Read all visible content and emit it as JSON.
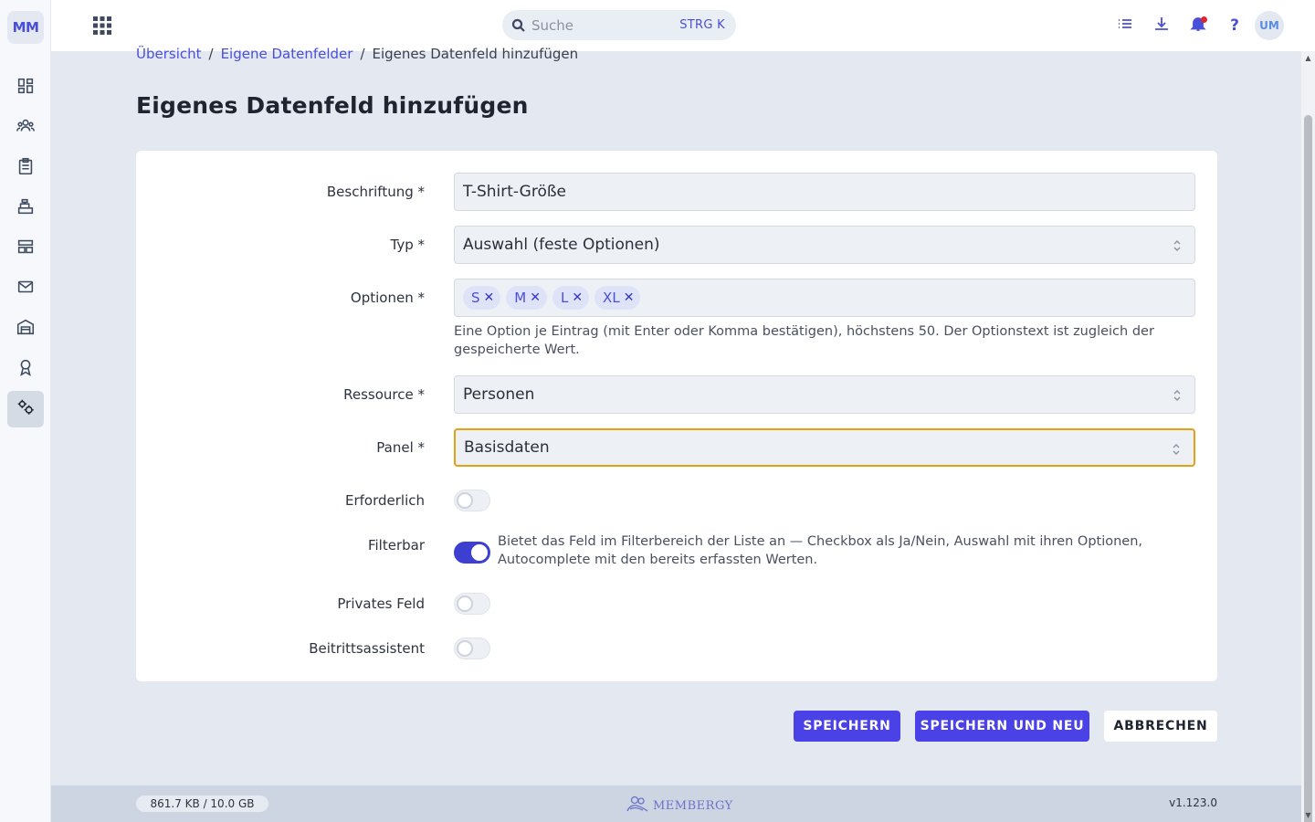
{
  "app": {
    "logo_initials": "MM",
    "user_initials": "UM"
  },
  "sidebar": {
    "items": [
      {
        "icon": "dashboard-icon",
        "active": false
      },
      {
        "icon": "people-icon",
        "active": false
      },
      {
        "icon": "clipboard-icon",
        "active": false
      },
      {
        "icon": "cash-register-icon",
        "active": false
      },
      {
        "icon": "layout-icon",
        "active": false
      },
      {
        "icon": "mail-icon",
        "active": false
      },
      {
        "icon": "warehouse-icon",
        "active": false
      },
      {
        "icon": "award-icon",
        "active": false
      },
      {
        "icon": "settings-gears-icon",
        "active": true
      }
    ]
  },
  "topbar": {
    "search_placeholder": "Suche",
    "search_shortcut": "STRG K",
    "help_label": "?",
    "notification_dot_color": "#e0262f"
  },
  "breadcrumb": [
    "Übersicht",
    "Eigene Datenfelder",
    "Eigenes Datenfeld hinzufügen"
  ],
  "page": {
    "title": "Eigenes Datenfeld hinzufügen"
  },
  "form": {
    "label_field": {
      "label": "Beschriftung *",
      "value": "T-Shirt-Größe"
    },
    "type_field": {
      "label": "Typ *",
      "value": "Auswahl (feste Optionen)"
    },
    "options_field": {
      "label": "Optionen *",
      "chips": [
        "S",
        "M",
        "L",
        "XL"
      ],
      "remove_symbol": "✕",
      "hint": "Eine Option je Eintrag (mit Enter oder Komma bestätigen), höchstens 50. Der Optionstext ist zugleich der gespeicherte Wert."
    },
    "resource_field": {
      "label": "Ressource *",
      "value": "Personen"
    },
    "panel_field": {
      "label": "Panel *",
      "value": "Basisdaten"
    },
    "required_toggle": {
      "label": "Erforderlich",
      "on": false
    },
    "filterable_toggle": {
      "label": "Filterbar",
      "on": true,
      "hint": "Bietet das Feld im Filterbereich der Liste an — Checkbox als Ja/Nein, Auswahl mit ihren Optionen, Autocomplete mit den bereits erfassten Werten."
    },
    "private_toggle": {
      "label": "Privates Feld",
      "on": false
    },
    "wizard_toggle": {
      "label": "Beitrittsassistent",
      "on": false
    }
  },
  "actions": {
    "save": "SPEICHERN",
    "save_new": "SPEICHERN UND NEU",
    "cancel": "ABBRECHEN"
  },
  "footer": {
    "storage": "861.7 KB / 10.0 GB",
    "brand": "MEMBERGY",
    "version": "v1.123.0"
  },
  "colors": {
    "accent": "#4a41e6",
    "focus_border": "#e3a114",
    "link": "#4a4fd9"
  }
}
